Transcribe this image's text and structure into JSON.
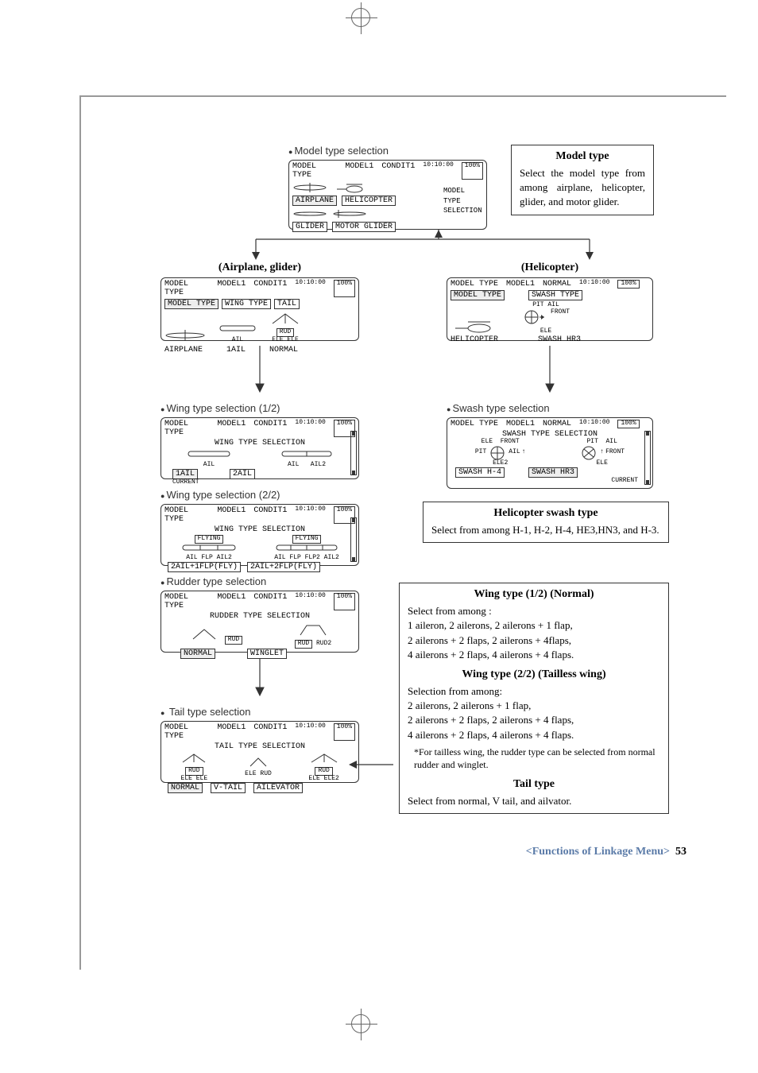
{
  "top_section": {
    "label": "Model type selection",
    "screen": {
      "title": "MODEL TYPE",
      "model": "MODEL1",
      "cond": "CONDIT1",
      "time": "10:10:00",
      "batt": "100%",
      "right_label1": "MODEL",
      "right_label2": "TYPE",
      "right_label3": "SELECTION",
      "buttons": [
        "AIRPLANE",
        "HELICOPTER",
        "GLIDER",
        "MOTOR GLIDER"
      ]
    },
    "info": {
      "title": "Model type",
      "body": "Select the model type from among airplane, helicopter, glider, and motor glider."
    }
  },
  "airplane_label": "(Airplane, glider)",
  "heli_label": "(Helicopter)",
  "airplane_screen": {
    "title": "MODEL TYPE",
    "model": "MODEL1",
    "cond": "CONDIT1",
    "time": "10:10:00",
    "batt": "100%",
    "btn_model": "MODEL TYPE",
    "btn_wing": "WING TYPE",
    "btn_tail": "TAIL",
    "val_model": "AIRPLANE",
    "val_wing": "1AIL",
    "val_tail": "NORMAL",
    "ail_label": "AIL",
    "rud_label": "RUD",
    "ele_label": "ELE"
  },
  "heli_screen": {
    "title": "MODEL TYPE",
    "model": "MODEL1",
    "cond": "NORMAL",
    "time": "10:10:00",
    "batt": "100%",
    "btn_model": "MODEL TYPE",
    "btn_swash": "SWASH TYPE",
    "val_model": "HELICOPTER",
    "val_swash": "SWASH HR3",
    "pit": "PIT",
    "ail": "AIL",
    "ele": "ELE",
    "front": "FRONT"
  },
  "wing12_label": "Wing type selection (1/2)",
  "wing12_screen": {
    "title": "MODEL TYPE",
    "model": "MODEL1",
    "cond": "CONDIT1",
    "time": "10:10:00",
    "batt": "100%",
    "sub": "WING TYPE SELECTION",
    "ail": "AIL",
    "ail2": "AIL2",
    "btn1": "1AIL",
    "btn2": "2AIL",
    "current": "CURRENT"
  },
  "swash_label": "Swash type selection",
  "swash_screen": {
    "title": "MODEL TYPE",
    "model": "MODEL1",
    "cond": "NORMAL",
    "time": "10:10:00",
    "batt": "100%",
    "sub": "SWASH TYPE SELECTION",
    "ele": "ELE",
    "front": "FRONT",
    "pit": "PIT",
    "ail": "AIL",
    "ele2": "ELE2",
    "btn1": "SWASH H-4",
    "btn2": "SWASH HR3",
    "current": "CURRENT"
  },
  "wing22_label": "Wing type selection (2/2)",
  "wing22_screen": {
    "title": "MODEL TYPE",
    "model": "MODEL1",
    "cond": "CONDIT1",
    "time": "10:10:00",
    "batt": "100%",
    "sub": "WING TYPE SELECTION",
    "flying": "FLYING",
    "ail": "AIL",
    "flp": "FLP",
    "ail2": "AIL2",
    "flp2": "FLP2",
    "btn1": "2AIL+1FLP(FLY)",
    "btn2": "2AIL+2FLP(FLY)"
  },
  "heli_swash_info": {
    "title": "Helicopter swash type",
    "body": "Select from among H-1, H-2, H-4, HE3,HN3, and H-3."
  },
  "rudder_label": "Rudder type selection",
  "rudder_screen": {
    "title": "MODEL TYPE",
    "model": "MODEL1",
    "cond": "CONDIT1",
    "time": "10:10:00",
    "batt": "100%",
    "sub": "RUDDER TYPE SELECTION",
    "rud": "RUD",
    "rud2": "RUD2",
    "btn1": "NORMAL",
    "btn2": "WINGLET"
  },
  "wing_info": {
    "title1": "Wing type (1/2) (Normal)",
    "l1": "Select from among :",
    "l2": "1 aileron, 2 ailerons, 2 ailerons + 1 flap,",
    "l3": "2 ailerons + 2 flaps,  2 ailerons + 4flaps,",
    "l4": "4 ailerons + 2 flaps,  4 ailerons + 4 flaps.",
    "title2": "Wing type (2/2) (Tailless wing)",
    "l5": "Selection from among:",
    "l6": "2 ailerons, 2 ailerons + 1 flap,",
    "l7": "2 ailerons + 2 flaps, 2 ailerons + 4 flaps,",
    "l8": "4 ailerons + 2 flaps,  4 ailerons + 4 flaps.",
    "note": "*For tailless wing, the rudder type can be selected from normal rudder and winglet.",
    "title3": "Tail type",
    "l9": "Select from  normal, V tail, and ailvator."
  },
  "tail_label": " Tail type selection",
  "tail_screen": {
    "title": "MODEL TYPE",
    "model": "MODEL1",
    "cond": "CONDIT1",
    "time": "10:10:00",
    "batt": "100%",
    "sub": "TAIL TYPE SELECTION",
    "rud": "RUD",
    "ele": "ELE",
    "ele2": "ELE2",
    "btn1": "NORMAL",
    "btn2": "V-TAIL",
    "btn3": "AILEVATOR"
  },
  "footer": {
    "text": "<Functions of Linkage Menu>",
    "page": "53"
  }
}
